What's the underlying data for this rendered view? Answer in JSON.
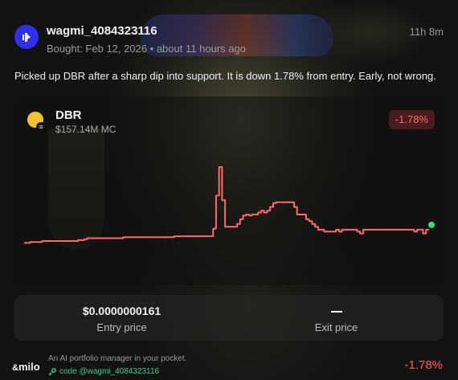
{
  "post": {
    "username": "wagmi_4084323116",
    "bought": "Bought: Feb 12, 2026 • about 11 hours ago",
    "time_ago": "11h 8m",
    "message": "Picked up DBR after a sharp dip into support. It is down 1.78% from entry. Early, not wrong."
  },
  "token": {
    "symbol": "DBR",
    "market_cap": "$157.14M MC",
    "change": "-1.78%"
  },
  "stats": {
    "entry_value": "$0.0000000161",
    "entry_label": "Entry price",
    "exit_value": "",
    "exit_label": "Exit price"
  },
  "footer": {
    "brand": "milo",
    "tagline": "An AI portfolio manager in your pocket.",
    "code": "code @wagmi_4084323116",
    "change": "-1.78%"
  },
  "colors": {
    "line": "#ff6b6b",
    "end_dot": "#2ee07a",
    "negative": "#ff5a5a",
    "avatar": "#2f2ff0",
    "code_green": "#34d18a"
  },
  "chart_data": {
    "type": "line",
    "title": "",
    "xlabel": "",
    "ylabel": "",
    "series": [
      {
        "values": [
          20,
          20,
          21,
          21,
          21,
          21,
          22,
          22,
          22,
          22,
          22,
          22,
          22,
          22,
          22,
          22,
          22,
          22,
          23,
          23,
          24,
          25,
          25,
          25,
          25,
          25,
          25,
          25,
          25,
          25,
          25,
          25,
          25,
          26,
          26,
          26,
          26,
          26,
          26,
          26,
          26,
          26,
          26,
          26,
          26,
          26,
          26,
          26,
          26,
          26,
          27,
          27,
          27,
          27,
          27,
          27,
          27,
          27,
          27,
          27,
          27,
          27,
          27,
          35,
          70,
          100,
          65,
          37,
          37,
          37,
          37,
          40,
          45,
          49,
          50,
          49,
          50,
          50,
          52,
          54,
          52,
          54,
          58,
          62,
          63,
          63,
          63,
          63,
          63,
          63,
          58,
          50,
          50,
          50,
          45,
          43,
          40,
          37,
          34,
          34,
          32,
          32,
          32,
          32,
          34,
          32,
          34,
          34,
          34,
          34,
          34,
          32,
          30,
          34,
          34,
          34,
          34,
          34,
          34,
          34,
          34,
          34,
          34,
          34,
          34,
          34,
          34,
          34,
          34,
          34,
          32,
          34,
          34,
          30,
          34,
          34
        ]
      }
    ]
  }
}
